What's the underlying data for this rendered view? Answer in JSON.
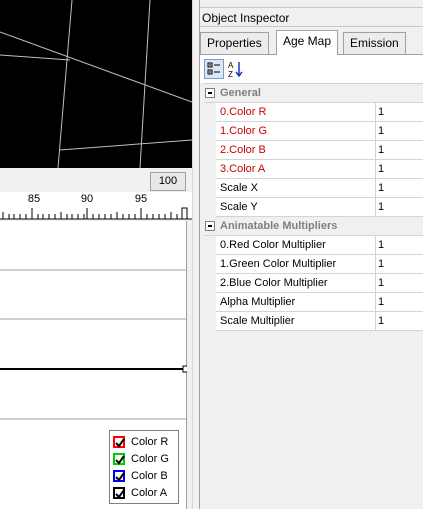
{
  "ruler": {
    "zoom_value": "100",
    "ticks": [
      "85",
      "90",
      "95"
    ]
  },
  "legend": {
    "items": [
      {
        "label": "Color R",
        "color": "#ff0000"
      },
      {
        "label": "Color G",
        "color": "#00cc00"
      },
      {
        "label": "Color B",
        "color": "#0000ff"
      },
      {
        "label": "Color A",
        "color": "#000000"
      }
    ]
  },
  "inspector": {
    "title": "Object Inspector",
    "tabs": [
      "Properties",
      "Age Map",
      "Emission"
    ],
    "active_tab": "Age Map",
    "toolbar": {
      "categorized_icon": "categorized-icon",
      "sort_icon": "sort-alpha-icon",
      "sort_label": "A↓Z"
    },
    "categories": [
      {
        "name": "General",
        "rows": [
          {
            "name": "0.Color R",
            "value": "1",
            "highlight": true
          },
          {
            "name": "1.Color G",
            "value": "1",
            "highlight": true
          },
          {
            "name": "2.Color B",
            "value": "1",
            "highlight": true
          },
          {
            "name": "3.Color A",
            "value": "1",
            "highlight": true
          },
          {
            "name": "Scale X",
            "value": "1",
            "highlight": false
          },
          {
            "name": "Scale Y",
            "value": "1",
            "highlight": false
          }
        ]
      },
      {
        "name": "Animatable Multipliers",
        "rows": [
          {
            "name": "0.Red Color Multiplier",
            "value": "1",
            "highlight": false
          },
          {
            "name": "1.Green Color Multiplier",
            "value": "1",
            "highlight": false
          },
          {
            "name": "2.Blue Color Multiplier",
            "value": "1",
            "highlight": false
          },
          {
            "name": "Alpha Multiplier",
            "value": "1",
            "highlight": false
          },
          {
            "name": "Scale Multiplier",
            "value": "1",
            "highlight": false
          }
        ]
      }
    ]
  }
}
